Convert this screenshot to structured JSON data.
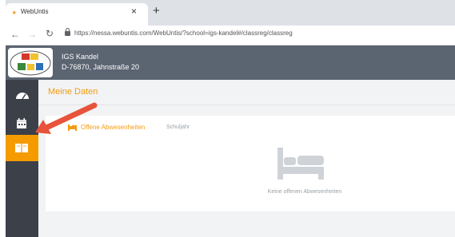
{
  "browser": {
    "tab_title": "WebUntis",
    "tab_close": "×",
    "new_tab": "+",
    "url": "https://nessa.webuntis.com/WebUntis/?school=igs-kandel#/classreg/classreg"
  },
  "header": {
    "school_name": "IGS Kandel",
    "school_address": "D-76870, Jahnstraße 20"
  },
  "sidebar": {
    "items": [
      {
        "icon": "dashboard-icon",
        "active": false
      },
      {
        "icon": "calendar-icon",
        "active": false
      },
      {
        "icon": "classreg-book-icon",
        "active": true
      }
    ]
  },
  "main": {
    "title": "Meine Daten",
    "card": {
      "title": "Offene Abwesenheiten",
      "subtitle": "Schuljahr",
      "empty_text": "Keine offenen Abwesenheiten"
    }
  },
  "colors": {
    "accent": "#f39c12",
    "sidebar_active": "#f59b00",
    "header_bg": "#5b6471",
    "sidebar_bg": "#3b4049",
    "annotation_arrow": "#e8533b"
  }
}
